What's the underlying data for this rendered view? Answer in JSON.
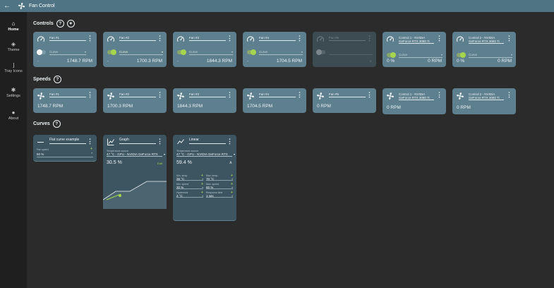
{
  "app": {
    "title": "Fan Control"
  },
  "sidebar": {
    "items": [
      {
        "label": "Home"
      },
      {
        "label": "Theme"
      },
      {
        "label": "Tray Icons"
      },
      {
        "label": "Settings"
      },
      {
        "label": "About"
      }
    ]
  },
  "sections": {
    "controls": "Controls",
    "speeds": "Speeds",
    "curves": "Curves"
  },
  "controls": [
    {
      "name": "Fan #1",
      "selection": "Curve",
      "speed": "1748.7 RPM",
      "enabled": false
    },
    {
      "name": "Fan #2",
      "selection": "Curve",
      "speed": "1700.3 RPM",
      "enabled": true
    },
    {
      "name": "Fan #3",
      "selection": "Curve",
      "speed": "1844.3 RPM",
      "enabled": true
    },
    {
      "name": "Fan #4",
      "selection": "Curve",
      "speed": "1704.5 RPM",
      "enabled": true
    },
    {
      "name": "Fan #5",
      "selection": "",
      "speed": "",
      "enabled": false
    },
    {
      "name": "Control 1 - NVIDIA GeForce RTX 3080 Ti",
      "selection": "Curve",
      "percent": "0 %",
      "speed": "0 RPM",
      "enabled": true
    },
    {
      "name": "Control 2 - NVIDIA GeForce RTX 3080 Ti",
      "selection": "Curve",
      "percent": "0 %",
      "speed": "0 RPM",
      "enabled": true
    }
  ],
  "speeds": [
    {
      "name": "Fan #1",
      "value": "1748.7 RPM"
    },
    {
      "name": "Fan #2",
      "value": "1700.3 RPM"
    },
    {
      "name": "Fan #3",
      "value": "1844.3 RPM"
    },
    {
      "name": "Fan #4",
      "value": "1704.5 RPM"
    },
    {
      "name": "Fan #5",
      "value": "0 RPM"
    },
    {
      "name": "Control 1 - NVIDIA GeForce RTX 3080 Ti",
      "value": "0 RPM"
    },
    {
      "name": "Control 2 - NVIDIA GeForce RTX 3080 Ti",
      "value": "0 RPM"
    }
  ],
  "curves": {
    "flat": {
      "name": "Flat curve example",
      "field_label": "Fan speed",
      "value": "50 %"
    },
    "graph": {
      "name": "Graph",
      "source_label": "Temperature source",
      "source": "47 °C - GPU - NVIDIA GeForce RTX",
      "value": "30.5 %",
      "edit": "Edit"
    },
    "linear": {
      "name": "Linear",
      "source_label": "Temperature source",
      "source": "47 °C - GPU - NVIDIA GeForce RTX",
      "value": "59.4 %",
      "fields": [
        {
          "label": "Min. temp.",
          "value": "35 °C"
        },
        {
          "label": "Max. temp.",
          "value": "70 °C"
        },
        {
          "label": "Min. speed",
          "value": "30 %"
        },
        {
          "label": "Max. speed",
          "value": "80 %"
        },
        {
          "label": "Hysteresis",
          "value": "2 °C"
        },
        {
          "label": "Response time",
          "value": "1 sec"
        }
      ]
    }
  },
  "colors": {
    "titlebar": "#4f7585",
    "card": "#5d7f8e",
    "card_disabled": "#3d4c53",
    "curve_card": "#3d5560",
    "accent_green": "#a5d54e",
    "background": "#2b2b2b",
    "sidebar": "#1f1f1f"
  },
  "icons": {
    "back": "arrow-left-icon",
    "logo": "fan-icon",
    "home": "home-icon",
    "theme": "paint-bucket-icon",
    "tray": "thermometer-icon",
    "settings": "gear-icon",
    "about": "info-icon",
    "help": "question-mark-icon",
    "wizard": "magic-wand-icon",
    "gauge": "gauge-icon",
    "menu": "more-vert-icon",
    "fan": "fan-icon",
    "flat": "flat-line-icon",
    "graph": "graph-chart-icon",
    "linear": "linear-chart-icon"
  }
}
